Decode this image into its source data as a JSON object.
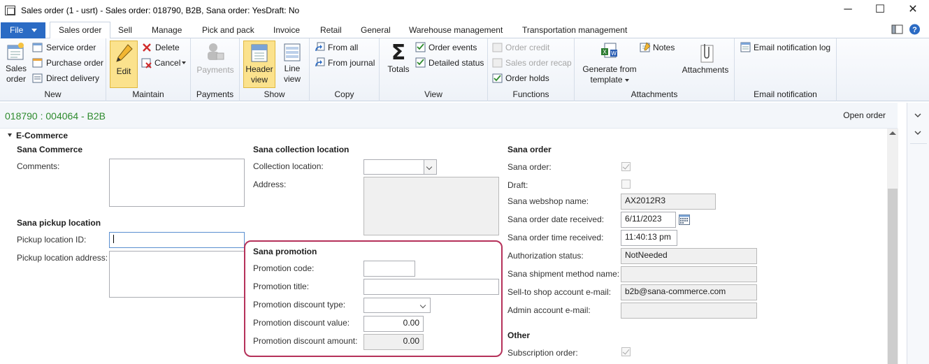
{
  "window": {
    "title": "Sales order (1 - usrt) - Sales order: 018790, B2B, Sana order: YesDraft: No",
    "minimize": "─",
    "maximize": "☐",
    "close": "✕"
  },
  "tabs": {
    "file": "File",
    "items": [
      "Sales order",
      "Sell",
      "Manage",
      "Pick and pack",
      "Invoice",
      "Retail",
      "General",
      "Warehouse management",
      "Transportation management"
    ],
    "active_index": 0
  },
  "ribbon": {
    "new": {
      "label": "New",
      "sales_order": "Sales\norder",
      "service_order": "Service order",
      "purchase_order": "Purchase order",
      "direct_delivery": "Direct delivery"
    },
    "maintain": {
      "label": "Maintain",
      "edit": "Edit",
      "delete": "Delete",
      "cancel": "Cancel"
    },
    "payments": {
      "label": "Payments",
      "payments": "Payments"
    },
    "show": {
      "label": "Show",
      "header_view": "Header\nview",
      "line_view": "Line\nview"
    },
    "copy": {
      "label": "Copy",
      "from_all": "From all",
      "from_journal": "From journal"
    },
    "view": {
      "label": "View",
      "totals": "Totals",
      "order_events": "Order events",
      "detailed_status": "Detailed status"
    },
    "functions": {
      "label": "Functions",
      "order_credit": "Order credit",
      "sales_order_recap": "Sales order recap",
      "order_holds": "Order holds"
    },
    "attachments": {
      "label": "Attachments",
      "generate_from_template": "Generate from\ntemplate",
      "notes": "Notes",
      "attachments": "Attachments"
    },
    "email_notification": {
      "label": "Email notification",
      "email_notification_log": "Email notification log"
    }
  },
  "header": {
    "order_id": "018790 : 004064 - B2B",
    "open_order": "Open order"
  },
  "ecommerce": {
    "section_title": "E-Commerce",
    "sana_commerce": {
      "title": "Sana Commerce",
      "comments_label": "Comments:",
      "comments_value": ""
    },
    "pickup": {
      "title": "Sana pickup location",
      "pickup_id_label": "Pickup location ID:",
      "pickup_id_value": "",
      "pickup_address_label": "Pickup location address:",
      "pickup_address_value": ""
    },
    "collection": {
      "title": "Sana collection location",
      "collection_location_label": "Collection location:",
      "collection_location_value": "",
      "address_label": "Address:",
      "address_value": ""
    },
    "promotion": {
      "title": "Sana promotion",
      "code_label": "Promotion code:",
      "code_value": "",
      "title_label": "Promotion title:",
      "title_value": "",
      "discount_type_label": "Promotion discount type:",
      "discount_type_value": "",
      "discount_value_label": "Promotion discount value:",
      "discount_value": "0.00",
      "discount_amount_label": "Promotion discount amount:",
      "discount_amount": "0.00"
    },
    "sana_order": {
      "title": "Sana order",
      "sana_order_label": "Sana order:",
      "sana_order_checked": true,
      "draft_label": "Draft:",
      "draft_checked": false,
      "webshop_name_label": "Sana webshop name:",
      "webshop_name": "AX2012R3",
      "date_received_label": "Sana order date received:",
      "date_received": "6/11/2023",
      "time_received_label": "Sana order time received:",
      "time_received": "11:40:13 pm",
      "authorization_status_label": "Authorization status:",
      "authorization_status": "NotNeeded",
      "shipment_method_label": "Sana shipment method name:",
      "shipment_method": "",
      "sell_to_email_label": "Sell-to shop account e-mail:",
      "sell_to_email": "b2b@sana-commerce.com",
      "admin_email_label": "Admin account e-mail:",
      "admin_email": ""
    },
    "other": {
      "title": "Other",
      "subscription_order_label": "Subscription order:",
      "subscription_order_checked": true
    }
  }
}
